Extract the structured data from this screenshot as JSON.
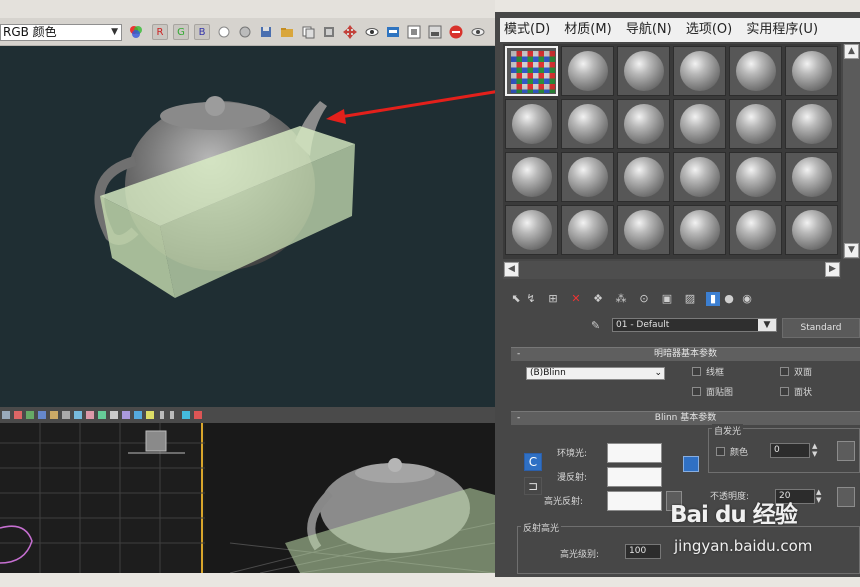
{
  "frame_buffer": {
    "channel_display": "RGB 颜色",
    "channels": [
      "R",
      "G",
      "B"
    ]
  },
  "material_editor": {
    "menu": [
      "模式(D)",
      "材质(M)",
      "导航(N)",
      "选项(O)",
      "实用程序(U)"
    ],
    "material_name": "01 - Default",
    "material_type": "Standard",
    "shader_rollout": {
      "title": "明暗器基本参数",
      "shader": "(B)Blinn",
      "options": [
        "线框",
        "双面",
        "面贴图",
        "面状"
      ]
    },
    "blinn_rollout": {
      "title": "Blinn 基本参数",
      "self_illum_title": "自发光",
      "self_illum_color_label": "颜色",
      "self_illum_value": "0",
      "ambient_label": "环境光:",
      "diffuse_label": "漫反射:",
      "specular_label": "高光反射:",
      "opacity_label": "不透明度:",
      "opacity_value": "20",
      "lock_left": "C",
      "lock_mid": "⊐",
      "specular_highlights_title": "反射高光",
      "specular_level_label": "高光级别:",
      "specular_level_value": "100"
    },
    "sample_slot_count": 24,
    "selected_slot": 0
  },
  "watermark": {
    "logo": "Bai du 经验",
    "url": "jingyan.baidu.com"
  },
  "colors": {
    "viewport_bg": "#1f2e33",
    "box_fill": "#cfe6b8",
    "arrow": "#e3201b",
    "editor_bg": "#474747"
  }
}
